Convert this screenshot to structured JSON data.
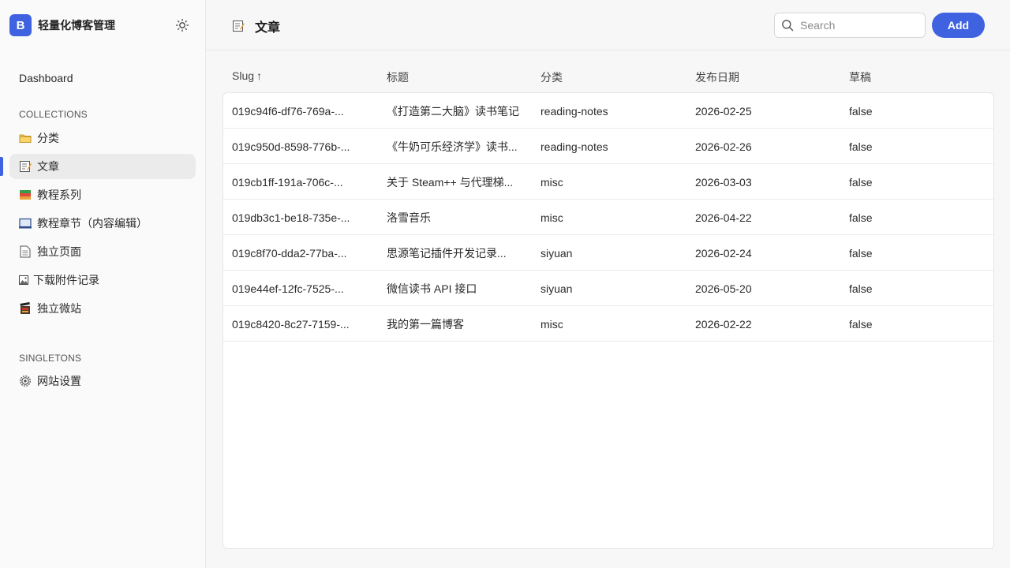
{
  "app": {
    "brand_letter": "B",
    "brand_title": "轻量化博客管理",
    "accent_color": "#3f63e0"
  },
  "sidebar": {
    "dashboard_label": "Dashboard",
    "collections_label": "COLLECTIONS",
    "collections": [
      {
        "label": "分类",
        "icon": "folder-icon"
      },
      {
        "label": "文章",
        "icon": "memo-icon",
        "active": true
      },
      {
        "label": "教程系列",
        "icon": "books-icon"
      },
      {
        "label": "教程章节（内容编辑）",
        "icon": "laptop-icon"
      },
      {
        "label": "独立页面",
        "icon": "page-icon"
      },
      {
        "label": "下载附件记录",
        "icon": "image-icon"
      },
      {
        "label": "独立微站",
        "icon": "film-icon"
      }
    ],
    "singletons_label": "SINGLETONS",
    "singletons": [
      {
        "label": "网站设置",
        "icon": "gear-icon"
      }
    ]
  },
  "header": {
    "title": "文章",
    "search_placeholder": "Search",
    "add_label": "Add"
  },
  "table": {
    "columns": [
      "Slug",
      "标题",
      "分类",
      "发布日期",
      "草稿"
    ],
    "sort_indicator": "↑",
    "rows": [
      [
        "019c94f6-df76-769a-...",
        "《打造第二大脑》读书笔记",
        "reading-notes",
        "2026-02-25",
        "false"
      ],
      [
        "019c950d-8598-776b-...",
        "《牛奶可乐经济学》读书...",
        "reading-notes",
        "2026-02-26",
        "false"
      ],
      [
        "019cb1ff-191a-706c-...",
        "关于 Steam++ 与代理梯...",
        "misc",
        "2026-03-03",
        "false"
      ],
      [
        "019db3c1-be18-735e-...",
        "洛雪音乐",
        "misc",
        "2026-04-22",
        "false"
      ],
      [
        "019c8f70-dda2-77ba-...",
        "思源笔记插件开发记录...",
        "siyuan",
        "2026-02-24",
        "false"
      ],
      [
        "019e44ef-12fc-7525-...",
        "微信读书 API 接口",
        "siyuan",
        "2026-05-20",
        "false"
      ],
      [
        "019c8420-8c27-7159-...",
        "我的第一篇博客",
        "misc",
        "2026-02-22",
        "false"
      ]
    ]
  }
}
